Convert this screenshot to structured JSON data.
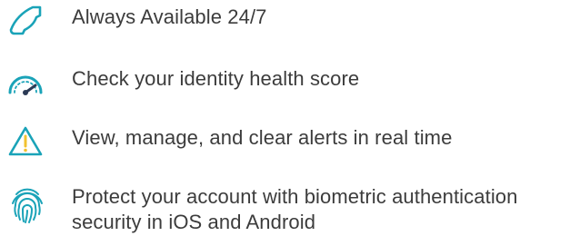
{
  "colors": {
    "accent": "#1aa3b8",
    "alert": "#f2c230",
    "gauge_needle": "#2b3a55",
    "text": "#3c3c3c"
  },
  "features": [
    {
      "icon": "phone-icon",
      "text": "Always Available 24/7"
    },
    {
      "icon": "gauge-icon",
      "text": "Check your identity health score"
    },
    {
      "icon": "warning-icon",
      "text": "View, manage, and clear alerts in real time"
    },
    {
      "icon": "fingerprint-icon",
      "text_line_1": "Protect your account with biometric authentication",
      "text_line_2": "security in iOS and Android"
    }
  ]
}
